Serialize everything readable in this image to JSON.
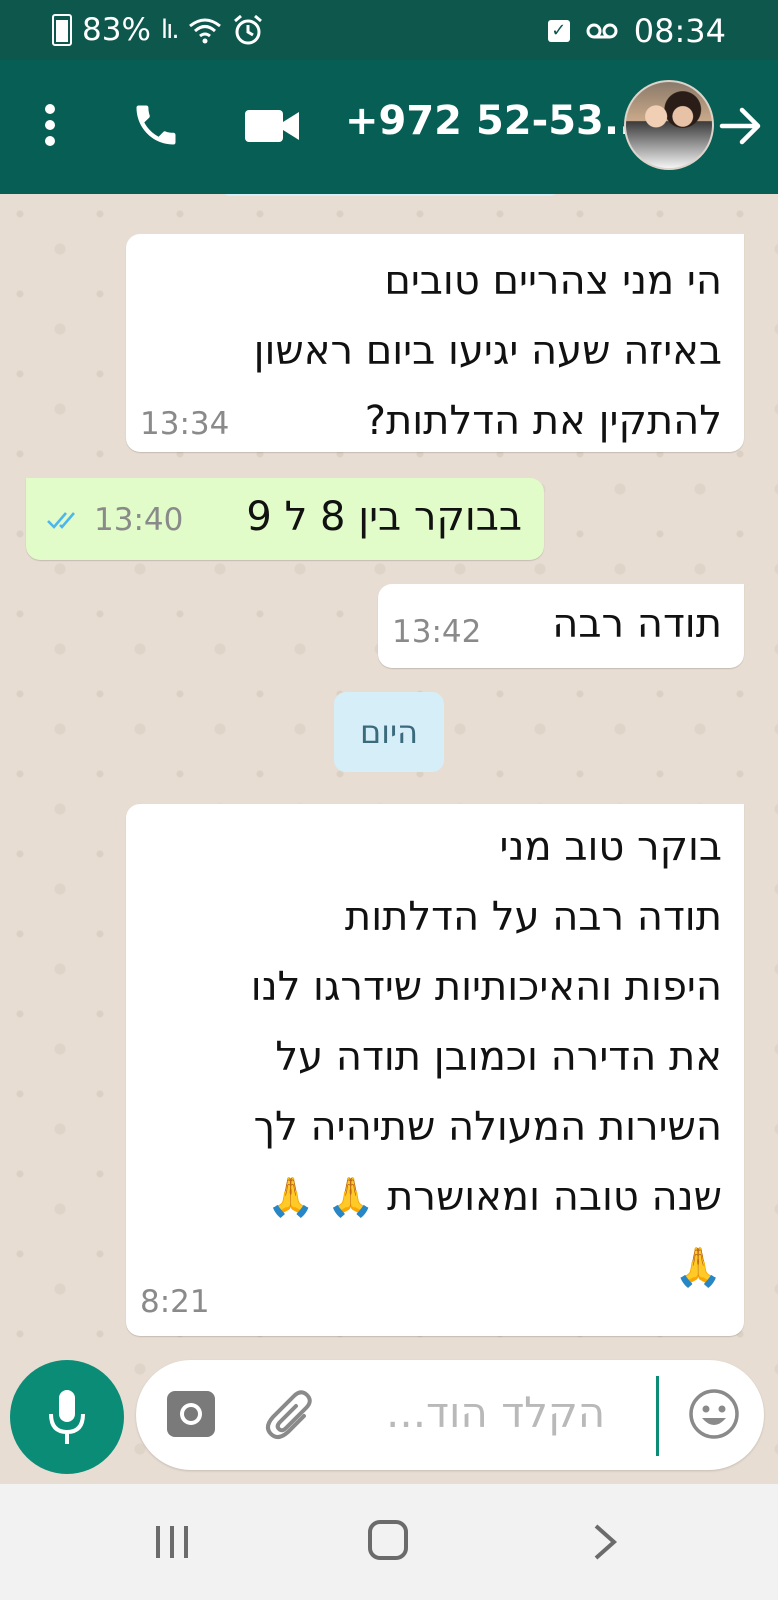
{
  "status_bar": {
    "battery": "83%",
    "time": "08:34"
  },
  "header": {
    "contact_name": "+972 52-53..."
  },
  "messages": [
    {
      "direction": "in",
      "text": "הי מני צהריים טובים\nבאיזה שעה יגיעו ביום ראשון\nלהתקין את הדלתות?",
      "time": "13:34"
    },
    {
      "direction": "out",
      "text": "בבוקר בין 8 ל 9",
      "time": "13:40",
      "status": "read"
    },
    {
      "direction": "in",
      "text": "תודה רבה",
      "time": "13:42"
    },
    {
      "direction": "in",
      "text": "בוקר טוב מני\nתודה רבה על הדלתות\nהיפות והאיכותיות שידרגו לנו\nאת הדירה וכמובן תודה על\nהשירות המעולה שתיהיה לך\nשנה טובה ומאושרת",
      "emoji": "🙏",
      "time": "8:21"
    }
  ],
  "day_separator": "היום",
  "composer": {
    "placeholder": "הקלד הוד..."
  },
  "colors": {
    "header": "#075e54",
    "status_bar": "#0d574d",
    "outgoing_bubble": "#e1fcc8",
    "incoming_bubble": "#ffffff",
    "mic_button": "#0b8c77",
    "read_ticks": "#4fb6ec"
  },
  "icons": [
    "battery-icon",
    "signal-icon",
    "wifi-icon",
    "alarm-icon",
    "checkbox-icon",
    "voicemail-icon",
    "menu-icon",
    "call-icon",
    "video-icon",
    "back-arrow-icon",
    "read-ticks-icon",
    "mic-icon",
    "camera-icon",
    "attach-icon",
    "emoji-icon",
    "recent-apps-icon",
    "home-icon",
    "back-nav-icon"
  ]
}
